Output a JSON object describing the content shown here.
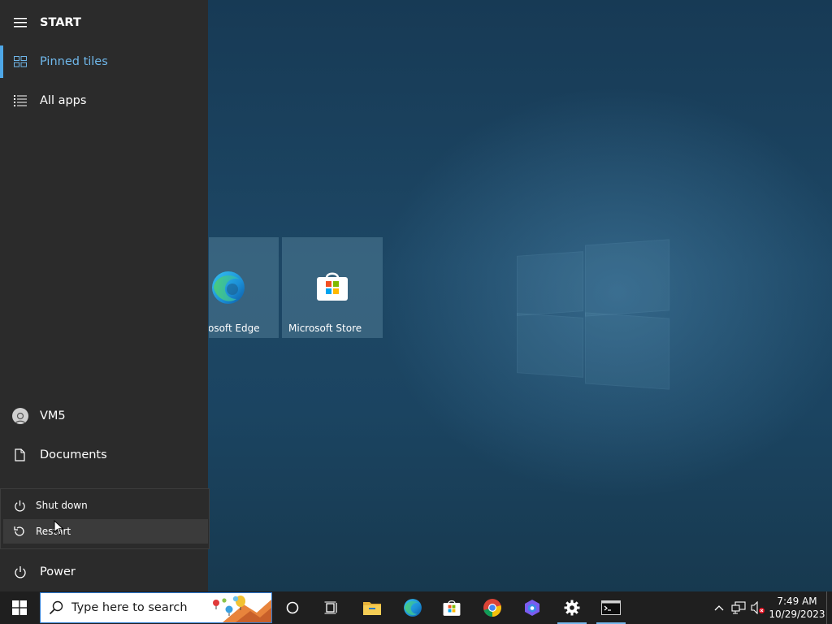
{
  "start": {
    "title": "START",
    "pinned_tiles": "Pinned tiles",
    "all_apps": "All apps",
    "user": "VM5",
    "documents": "Documents",
    "power": "Power"
  },
  "power_menu": {
    "shut_down": "Shut down",
    "restart": "Restart"
  },
  "tiles": [
    {
      "label": "osoft Edge",
      "icon": "edge-icon"
    },
    {
      "label": "Microsoft Store",
      "icon": "store-icon"
    }
  ],
  "taskbar": {
    "search_placeholder": "Type here to search",
    "apps": [
      "cortana-icon",
      "task-view-icon",
      "file-explorer-icon",
      "edge-icon",
      "store-icon",
      "chrome-icon",
      "copilot-icon",
      "settings-icon",
      "terminal-icon"
    ],
    "time": "7:49 AM",
    "date": "10/29/2023"
  },
  "colors": {
    "accent": "#4ea7e7",
    "start_bg": "#2b2b2b",
    "taskbar_bg": "#1f1f1f"
  }
}
